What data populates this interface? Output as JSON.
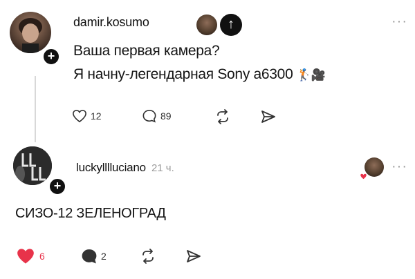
{
  "post": {
    "username": "damir.kosumo",
    "line1": "Ваша первая камера?",
    "line2": "Я начну-легендарная Sony a6300",
    "line2_emoji": "🏌️🎥",
    "likes": "12",
    "comments": "89"
  },
  "reply": {
    "username": "luckylllluciano",
    "time": "21 ч.",
    "text": "СИЗО-12 ЗЕЛЕНОГРАД",
    "likes": "6",
    "comments": "2"
  },
  "ui": {
    "more_glyph": "···",
    "plus_glyph": "+",
    "arrow_glyph": "↑"
  },
  "colors": {
    "like_active": "#e8334a",
    "text": "#151515",
    "muted": "#9a9a9a"
  }
}
